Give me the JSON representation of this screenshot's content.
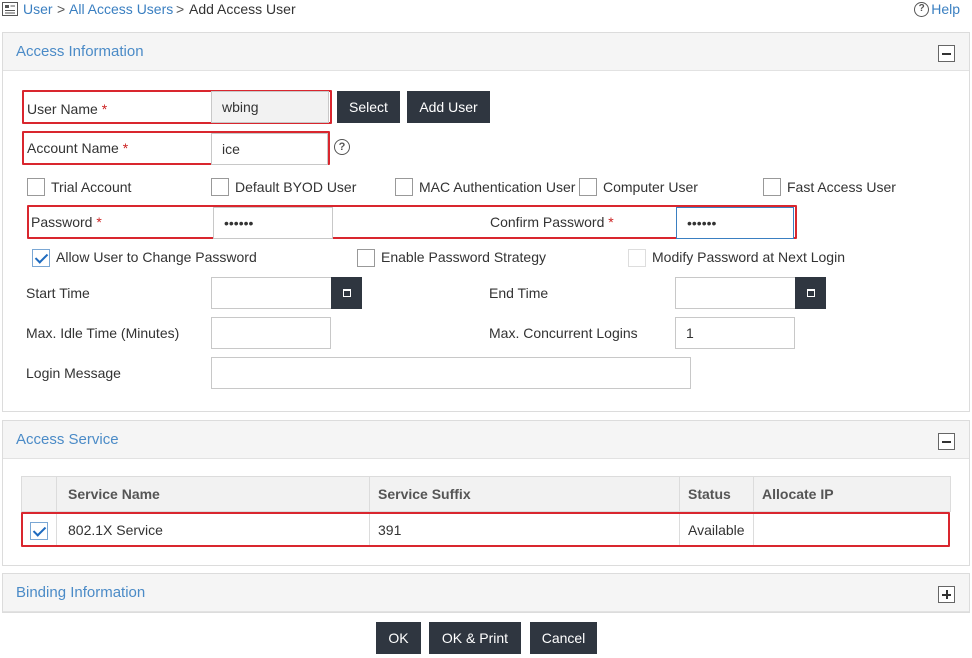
{
  "breadcrumb": {
    "items": [
      {
        "label": "User",
        "link": true
      },
      {
        "label": "All Access Users",
        "link": true
      },
      {
        "label": "Add Access User",
        "link": false
      }
    ],
    "separator": ">",
    "icon": "user-list-icon"
  },
  "help": {
    "label": "Help",
    "glyph": "?"
  },
  "access_information": {
    "title": "Access Information",
    "user_name": {
      "label": "User Name",
      "required": "*",
      "value": "wbing"
    },
    "select_button": "Select",
    "add_user_button": "Add User",
    "account_name": {
      "label": "Account Name",
      "required": "*",
      "value": "ice"
    },
    "help_glyph": "?",
    "checkboxes": [
      {
        "label": "Trial Account",
        "checked": false
      },
      {
        "label": "Default BYOD User",
        "checked": false
      },
      {
        "label": "MAC Authentication User",
        "checked": false
      },
      {
        "label": "Computer User",
        "checked": false
      },
      {
        "label": "Fast Access User",
        "checked": false
      }
    ],
    "password": {
      "label": "Password",
      "required": "*",
      "value": "••••••"
    },
    "confirm_password": {
      "label": "Confirm Password",
      "required": "*",
      "value": "••••••"
    },
    "password_options": [
      {
        "label": "Allow User to Change Password",
        "checked": true
      },
      {
        "label": "Enable Password Strategy",
        "checked": false
      },
      {
        "label": "Modify Password at Next Login",
        "checked": false
      }
    ],
    "start_time": {
      "label": "Start Time",
      "value": ""
    },
    "end_time": {
      "label": "End Time",
      "value": ""
    },
    "max_idle_time": {
      "label": "Max. Idle Time (Minutes)",
      "value": ""
    },
    "max_concurrent_logins": {
      "label": "Max. Concurrent Logins",
      "value": "1"
    },
    "login_message": {
      "label": "Login Message",
      "value": ""
    }
  },
  "access_service": {
    "title": "Access Service",
    "columns": [
      "Service Name",
      "Service Suffix",
      "Status",
      "Allocate IP"
    ],
    "rows": [
      {
        "checked": true,
        "service_name": "802.1X Service",
        "service_suffix": "391",
        "status": "Available",
        "allocate_ip": ""
      }
    ]
  },
  "binding_information": {
    "title": "Binding Information"
  },
  "footer": {
    "ok": "OK",
    "ok_print": "OK & Print",
    "cancel": "Cancel"
  },
  "colors": {
    "accent": "#4b8bc7",
    "button": "#2f3640",
    "highlight": "#d9262e"
  }
}
